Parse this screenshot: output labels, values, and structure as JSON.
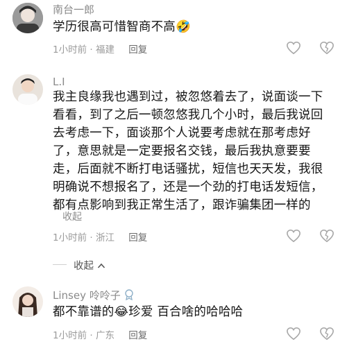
{
  "comments": [
    {
      "username": "南台一郎",
      "text": "学历很高可惜智商不高",
      "emoji": "🤣",
      "time": "1小时前",
      "location": "福建",
      "reply_label": "回复"
    },
    {
      "username": "L.I",
      "lines": [
        "我主良缘我也遇到过，被忽悠着去了，说面谈一下",
        "看看，到了之后一顿忽悠我几个小时，最后我说回",
        "去考虑一下，面谈那个人说要考虑就在那考虑好",
        "了，意思就是一定要报名交钱，最后我执意要要",
        "走，后面就不断打电话骚扰，短信也天天发，我很",
        "明确说不想报名了，还是一个劲的打电话发短信，",
        "都有点影响到我正常生活了，跟诈骗集团一样的"
      ],
      "collapse_label": "收起",
      "time": "1小时前",
      "location": "浙江",
      "reply_label": "回复"
    },
    {
      "username": "Linsey",
      "username_suffix": "呤呤子",
      "text_part1": "都不靠谱的",
      "emoji": "😂",
      "text_part2": "珍爱 百合啥的哈哈哈",
      "time": "1小时前",
      "location": "广东",
      "reply_label": "回复"
    }
  ],
  "collapse_replies_label": "收起",
  "separator": "·",
  "icons": {
    "like": "heart-icon",
    "dislike": "broken-heart-icon",
    "collapse_chevron": "chevron-up-icon"
  }
}
